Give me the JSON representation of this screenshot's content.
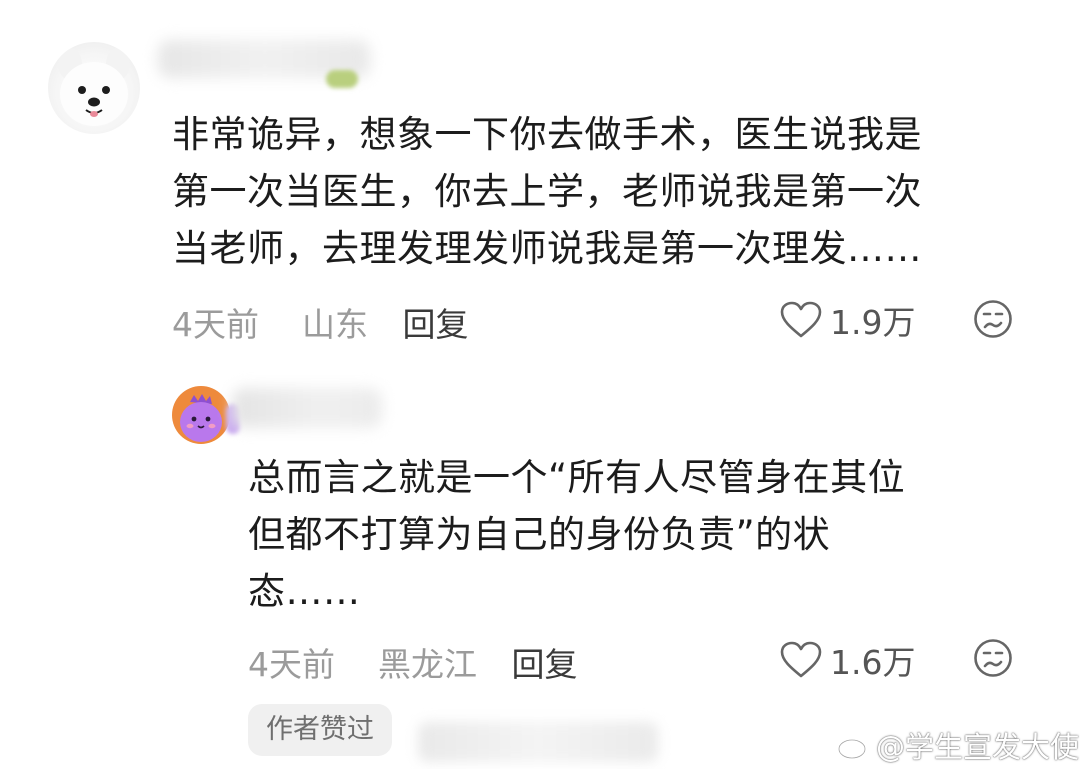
{
  "comments": [
    {
      "text_lines": [
        "非常诡异，想象一下你去做手术，医生说我是",
        "第一次当医生，你去上学，老师说我是第一次",
        "当老师，去理发理发师说我是第一次理发……"
      ],
      "time": "4天前",
      "location": "山东",
      "reply_label": "回复",
      "likes": "1.9万"
    },
    {
      "text_lines": [
        "总而言之就是一个“所有人尽管身在其位",
        "但都不打算为自己的身份负责”的状",
        "态……"
      ],
      "time": "4天前",
      "location": "黑龙江",
      "reply_label": "回复",
      "likes": "1.6万",
      "author_badge": "作者赞过"
    }
  ],
  "watermark": {
    "text": "@学生宣发大使",
    "icon": "weibo-icon"
  },
  "colors": {
    "text": "#1c1c1c",
    "meta": "#9b9b9b",
    "reply": "#3a3a3a",
    "badge_bg": "#f0f0f0",
    "dino_avatar_bg": "#ee8a3c",
    "dino_body": "#b978ec"
  }
}
